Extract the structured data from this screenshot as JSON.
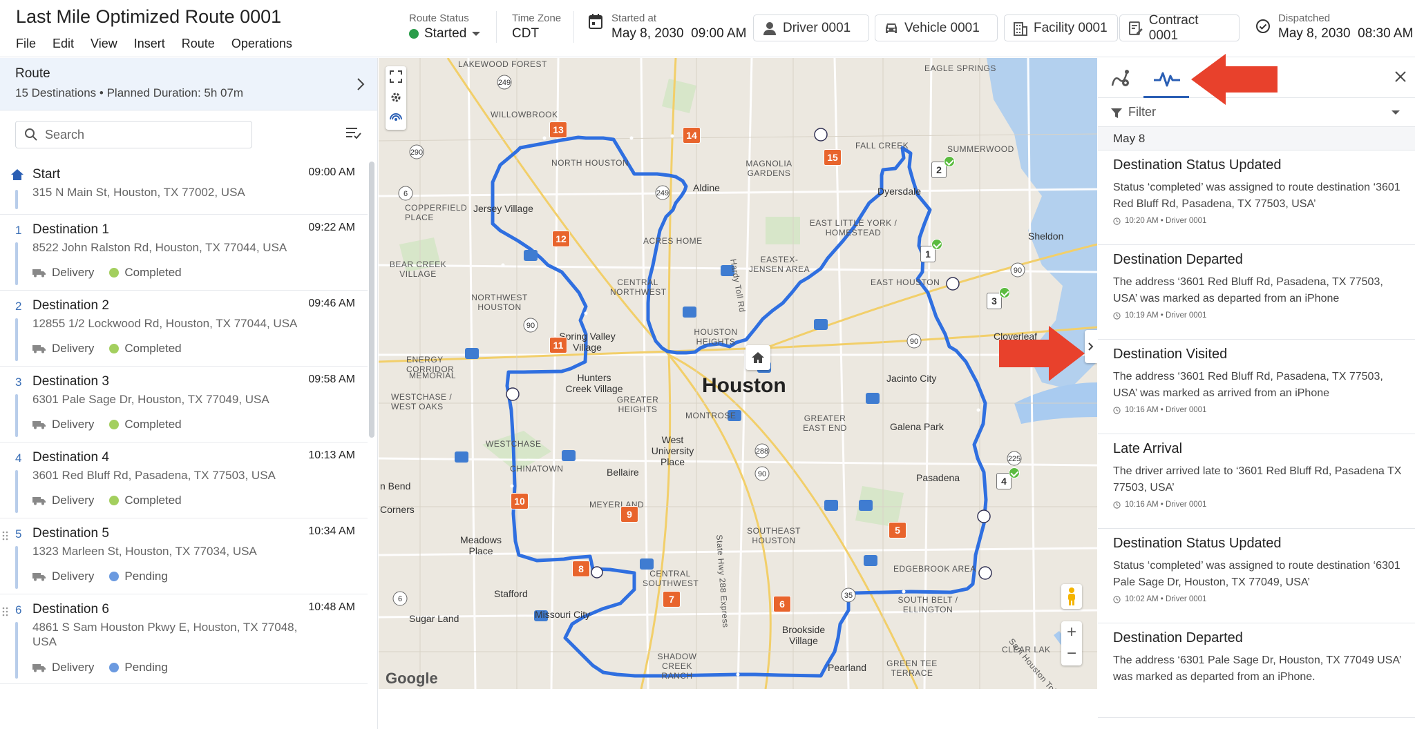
{
  "header": {
    "title": "Last Mile Optimized Route 0001",
    "menu": [
      "File",
      "Edit",
      "View",
      "Insert",
      "Route",
      "Operations"
    ],
    "route_status": {
      "label": "Route Status",
      "value": "Started"
    },
    "time_zone": {
      "label": "Time Zone",
      "value": "CDT"
    },
    "started_at": {
      "label": "Started at",
      "value": "May 8, 2030  09:00 AM"
    },
    "driver": "Driver 0001",
    "vehicle": "Vehicle 0001",
    "facility": "Facility 0001",
    "contract": "Contract 0001",
    "dispatched": {
      "label": "Dispatched",
      "value": "May 8, 2030  08:30 AM"
    }
  },
  "route_card": {
    "title": "Route",
    "subtitle": "15 Destinations • Planned Duration: 5h 07m"
  },
  "search": {
    "placeholder": "Search"
  },
  "stops": [
    {
      "num": "",
      "name": "Start",
      "address": "315 N Main St, Houston, TX 77002, USA",
      "time": "09:00 AM",
      "type": "",
      "status": "",
      "status_color": ""
    },
    {
      "num": "1",
      "name": "Destination 1",
      "address": "8522 John Ralston Rd, Houston, TX 77044, USA",
      "time": "09:22 AM",
      "type": "Delivery",
      "status": "Completed",
      "status_color": "#a3cf5e"
    },
    {
      "num": "2",
      "name": "Destination 2",
      "address": "12855 1/2 Lockwood Rd, Houston, TX 77044, USA",
      "time": "09:46 AM",
      "type": "Delivery",
      "status": "Completed",
      "status_color": "#a3cf5e"
    },
    {
      "num": "3",
      "name": "Destination 3",
      "address": "6301 Pale Sage Dr, Houston, TX 77049, USA",
      "time": "09:58 AM",
      "type": "Delivery",
      "status": "Completed",
      "status_color": "#a3cf5e"
    },
    {
      "num": "4",
      "name": "Destination 4",
      "address": "3601 Red Bluff Rd, Pasadena, TX 77503, USA",
      "time": "10:13 AM",
      "type": "Delivery",
      "status": "Completed",
      "status_color": "#a3cf5e"
    },
    {
      "num": "5",
      "name": "Destination 5",
      "address": "1323 Marleen St, Houston, TX 77034, USA",
      "time": "10:34 AM",
      "type": "Delivery",
      "status": "Pending",
      "status_color": "#6b9ae0"
    },
    {
      "num": "6",
      "name": "Destination 6",
      "address": "4861 S Sam Houston Pkwy E, Houston, TX 77048, USA",
      "time": "10:48 AM",
      "type": "Delivery",
      "status": "Pending",
      "status_color": "#6b9ae0"
    }
  ],
  "map": {
    "city_label": "Houston",
    "labels": [
      "LAKEWOOD FOREST",
      "WILLOWBROOK",
      "EAGLE SPRINGS",
      "SUMMERWOOD",
      "FALL CREEK",
      "COPPERFIELD PLACE",
      "NORTH HOUSTON",
      "MAGNOLIA GARDENS",
      "Aldine",
      "Dyersdale",
      "Jersey Village",
      "ACRES HOME",
      "EAST LITTLE YORK / HOMESTEAD",
      "Sheldon",
      "BEAR CREEK VILLAGE",
      "NORTHWEST HOUSTON",
      "CENTRAL NORTHWEST",
      "EASTEX-JENSEN AREA",
      "EAST HOUSTON",
      "Spring Valley Village",
      "HOUSTON HEIGHTS",
      "Cloverleaf",
      "ENERGY CORRIDOR",
      "MEMORIAL",
      "Hunters Creek Village",
      "GREATER HEIGHTS",
      "Jacinto City",
      "WESTCHASE / WEST OAKS",
      "MONTROSE",
      "GREATER EAST END",
      "Galena Park",
      "WESTCHASE",
      "West University Place",
      "Bellaire",
      "CHINATOWN",
      "Pasadena",
      "n Bend",
      "Corners",
      "Meadows Place",
      "MEYERLAND",
      "SOUTHEAST HOUSTON",
      "EDGEBROOK AREA",
      "Stafford",
      "CENTRAL SOUTHWEST",
      "Missouri City",
      "SOUTH BELT / ELLINGTON",
      "Sugar Land",
      "SHADOW CREEK RANCH",
      "Brookside Village",
      "Pearland",
      "GREEN TEE TERRACE",
      "CLEAR LAK",
      "Hardy Toll Rd",
      "Sam Houston Tollway",
      "State Hwy 288 Express"
    ],
    "pins": [
      "13",
      "14",
      "15",
      "12",
      "11",
      "10",
      "9",
      "8",
      "7",
      "6",
      "5"
    ],
    "done_pins": [
      "1",
      "2",
      "3",
      "4"
    ],
    "attribution": "Google"
  },
  "panel": {
    "filter_label": "Filter",
    "date": "May 8",
    "events": [
      {
        "title": "Destination Status Updated",
        "desc": "Status ‘completed’ was assigned to route destination ‘3601 Red Bluff Rd, Pasadena, TX 77503, USA’",
        "meta": "10:20 AM • Driver 0001"
      },
      {
        "title": "Destination Departed",
        "desc": "The address ‘3601 Red Bluff Rd, Pasadena, TX 77503, USA’ was marked as departed from an iPhone",
        "meta": "10:19 AM • Driver 0001"
      },
      {
        "title": "Destination Visited",
        "desc": "The address ‘3601 Red Bluff Rd, Pasadena, TX 77503, USA’ was marked as arrived from an iPhone",
        "meta": "10:16 AM • Driver 0001"
      },
      {
        "title": "Late Arrival",
        "desc": "The driver arrived late to ‘3601 Red Bluff Rd, Pasadena TX 77503, USA’",
        "meta": "10:16 AM • Driver 0001"
      },
      {
        "title": "Destination Status Updated",
        "desc": "Status ‘completed’ was assigned to route destination ‘6301 Pale Sage Dr, Houston, TX 77049, USA’",
        "meta": "10:02 AM • Driver 0001"
      },
      {
        "title": "Destination Departed",
        "desc": "The address ‘6301 Pale Sage Dr, Houston, TX 77049 USA’ was marked as departed from an iPhone.",
        "meta": ""
      }
    ]
  },
  "colors": {
    "accent": "#2b5fb4",
    "route": "#2f6fe0",
    "pin": "#e8642c",
    "annotation": "#e8412c",
    "completed": "#a3cf5e",
    "pending": "#6b9ae0"
  }
}
